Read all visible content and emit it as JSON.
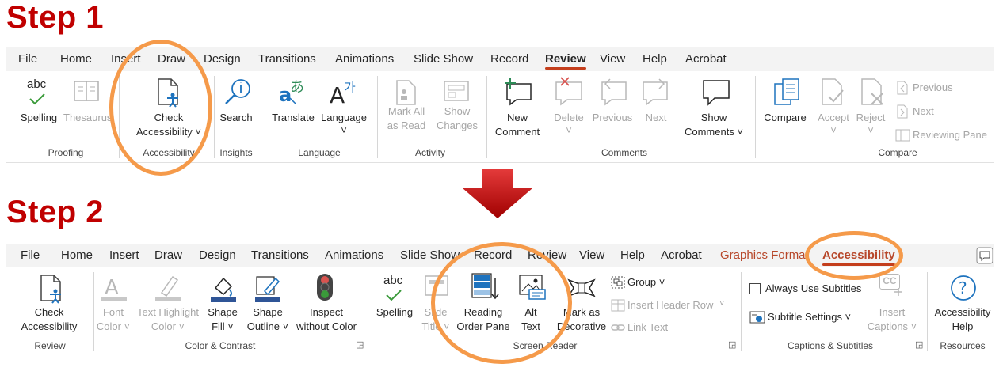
{
  "step1": {
    "title": "Step 1"
  },
  "step2": {
    "title": "Step 2"
  },
  "ribbon1": {
    "tabs": [
      "File",
      "Home",
      "Insert",
      "Draw",
      "Design",
      "Transitions",
      "Animations",
      "Slide Show",
      "Record",
      "Review",
      "View",
      "Help",
      "Acrobat"
    ],
    "active_tab": "Review",
    "buttons": {
      "spelling": "Spelling",
      "thesaurus": "Thesaurus",
      "check1": "Check",
      "check2": "Accessibility ˅",
      "search": "Search",
      "translate": "Translate",
      "language": "Language",
      "language_caret": "˅",
      "markall1": "Mark All",
      "markall2": "as Read",
      "show1": "Show",
      "show2": "Changes",
      "new1": "New",
      "new2": "Comment",
      "delete": "Delete",
      "delete_caret": "˅",
      "previous": "Previous",
      "next": "Next",
      "showc1": "Show",
      "showc2": "Comments ˅",
      "compare": "Compare",
      "accept": "Accept",
      "accept_caret": "˅",
      "reject": "Reject",
      "reject_caret": "˅",
      "prev_small": "Previous",
      "next_small": "Next",
      "reviewing_pane": "Reviewing Pane"
    },
    "groups": {
      "proofing": "Proofing",
      "accessibility": "Accessibility",
      "insights": "Insights",
      "language": "Language",
      "activity": "Activity",
      "comments": "Comments",
      "compare": "Compare"
    },
    "spelling_icon_text": "abc"
  },
  "ribbon2": {
    "tabs": [
      "File",
      "Home",
      "Insert",
      "Draw",
      "Design",
      "Transitions",
      "Animations",
      "Slide Show",
      "Record",
      "Review",
      "View",
      "Help",
      "Acrobat"
    ],
    "context_tab": "Graphics Format",
    "active_tab": "Accessibility",
    "buttons": {
      "check1": "Check",
      "check2": "Accessibility",
      "font1": "Font",
      "font2": "Color ˅",
      "texthl1": "Text Highlight",
      "texthl2": "Color ˅",
      "shapefill1": "Shape",
      "shapefill2": "Fill ˅",
      "shapeout1": "Shape",
      "shapeout2": "Outline ˅",
      "inspect1": "Inspect",
      "inspect2": "without Color",
      "spelling": "Spelling",
      "slide1": "Slide",
      "slide2": "Title ˅",
      "reading1": "Reading",
      "reading2": "Order Pane",
      "alt1": "Alt",
      "alt2": "Text",
      "mark1": "Mark as",
      "mark2": "Decorative",
      "group": "Group ˅",
      "insert_header_row": "Insert Header Row",
      "link_text": "Link Text",
      "always_subtitles": "Always Use Subtitles",
      "subtitle_settings": "Subtitle Settings ˅",
      "insertcap1": "Insert",
      "insertcap2": "Captions ˅",
      "help1": "Accessibility",
      "help2": "Help"
    },
    "groups": {
      "review": "Review",
      "color_contrast": "Color & Contrast",
      "screen_reader": "Screen Reader",
      "captions": "Captions & Subtitles",
      "resources": "Resources"
    },
    "spelling_icon_text": "abc",
    "cc_icon_text": "CC"
  },
  "colors": {
    "step_title": "#c00000",
    "highlight_oval": "#f59a4a",
    "arrow": "#c00000",
    "active_underline": "#c43e1c"
  }
}
